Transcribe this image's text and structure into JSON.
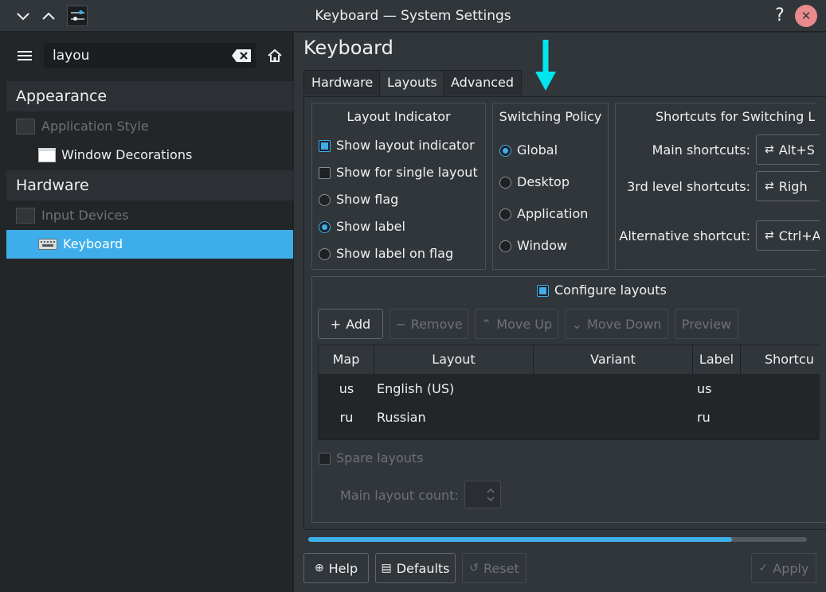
{
  "window": {
    "title": "Keyboard — System Settings",
    "help_glyph": "?",
    "close_glyph": "✕"
  },
  "sidebar": {
    "search_value": "layou",
    "categories": [
      {
        "label": "Appearance",
        "items": [
          {
            "label": "Application Style",
            "state": "disabled"
          },
          {
            "label": "Window Decorations",
            "state": "normal"
          }
        ]
      },
      {
        "label": "Hardware",
        "items": [
          {
            "label": "Input Devices",
            "state": "disabled"
          },
          {
            "label": "Keyboard",
            "state": "selected"
          }
        ]
      }
    ]
  },
  "main": {
    "heading": "Keyboard",
    "tabs": [
      {
        "label": "Hardware",
        "active": false
      },
      {
        "label": "Layouts",
        "active": true
      },
      {
        "label": "Advanced",
        "active": false
      }
    ],
    "layout_indicator": {
      "title": "Layout Indicator",
      "options": [
        {
          "label": "Show layout indicator",
          "type": "checkbox",
          "checked": true
        },
        {
          "label": "Show for single layout",
          "type": "checkbox",
          "checked": false
        },
        {
          "label": "Show flag",
          "type": "radio",
          "checked": false
        },
        {
          "label": "Show label",
          "type": "radio",
          "checked": true
        },
        {
          "label": "Show label on flag",
          "type": "radio",
          "checked": false
        }
      ]
    },
    "switching_policy": {
      "title": "Switching Policy",
      "options": [
        {
          "label": "Global",
          "checked": true
        },
        {
          "label": "Desktop",
          "checked": false
        },
        {
          "label": "Application",
          "checked": false
        },
        {
          "label": "Window",
          "checked": false
        }
      ]
    },
    "shortcuts": {
      "title": "Shortcuts for Switching L",
      "rows": [
        {
          "label": "Main shortcuts:",
          "value": "Alt+S"
        },
        {
          "label": "3rd level shortcuts:",
          "value": "Righ"
        },
        {
          "label": "Alternative shortcut:",
          "value": "Ctrl+A"
        }
      ]
    },
    "configure": {
      "label": "Configure layouts",
      "checked": true,
      "buttons": [
        {
          "label": "Add",
          "glyph": "+",
          "enabled": true
        },
        {
          "label": "Remove",
          "glyph": "−",
          "enabled": false
        },
        {
          "label": "Move Up",
          "glyph": "⌃",
          "enabled": false
        },
        {
          "label": "Move Down",
          "glyph": "⌄",
          "enabled": false
        },
        {
          "label": "Preview",
          "glyph": "",
          "enabled": false
        }
      ],
      "table": {
        "columns": [
          "Map",
          "Layout",
          "Variant",
          "Label",
          "Shortcu"
        ],
        "rows": [
          {
            "map": "us",
            "layout": "English (US)",
            "variant": "",
            "label": "us",
            "shortcut": ""
          },
          {
            "map": "ru",
            "layout": "Russian",
            "variant": "",
            "label": "ru",
            "shortcut": ""
          }
        ]
      },
      "spare_layouts": {
        "label": "Spare layouts",
        "checked": false
      },
      "main_layout_count": {
        "label": "Main layout count:",
        "value": ""
      }
    },
    "scroll_progress": 0.85
  },
  "footer": {
    "help": "Help",
    "defaults": "Defaults",
    "reset": "Reset",
    "apply": "Apply"
  },
  "colors": {
    "accent": "#3daee9",
    "annotation_arrow": "#00e5ee",
    "window_bg": "#31363b",
    "view_bg": "#232629"
  }
}
